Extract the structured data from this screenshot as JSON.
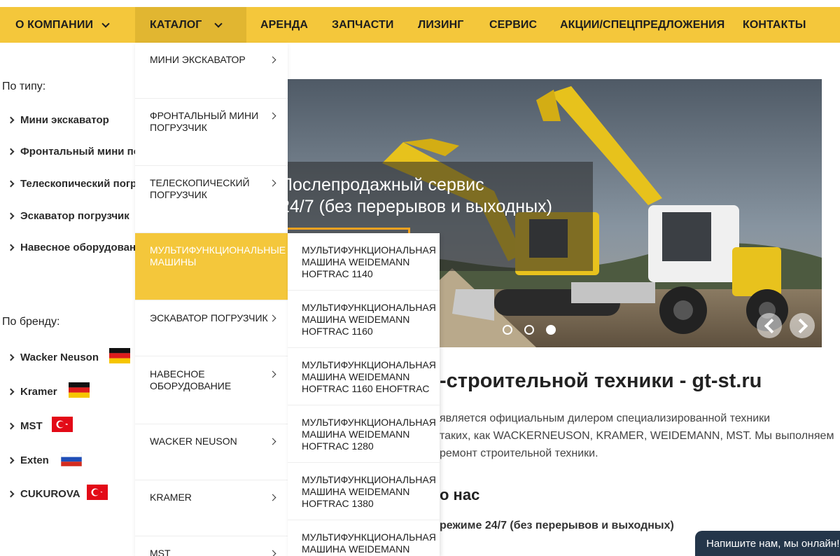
{
  "nav": {
    "items": [
      {
        "label": "О КОМПАНИИ",
        "has_dropdown": true
      },
      {
        "label": "КАТАЛОГ",
        "has_dropdown": true,
        "active": true
      },
      {
        "label": "АРЕНДА"
      },
      {
        "label": "ЗАПЧАСТИ"
      },
      {
        "label": "ЛИЗИНГ"
      },
      {
        "label": "СЕРВИС"
      },
      {
        "label": "АКЦИИ/СПЕЦПРЕДЛОЖЕНИЯ"
      },
      {
        "label": "КОНТАКТЫ"
      }
    ],
    "background": "#f4c73b"
  },
  "sidebar": {
    "by_type_label": "По типу:",
    "types": [
      "Мини экскаватор",
      "Фронтальный мини погрузчик",
      "Телескопический погрузчик",
      "Эскаватор погрузчик",
      "Навесное оборудование"
    ],
    "by_brand_label": "По бренду:",
    "brands": [
      {
        "label": "Wacker Neuson",
        "flag": "germany-flag-icon"
      },
      {
        "label": "Kramer",
        "flag": "germany-flag-icon"
      },
      {
        "label": "MST",
        "flag": "turkey-flag-icon"
      },
      {
        "label": "Exten",
        "flag": "russia-flag-icon"
      },
      {
        "label": "CUKUROVA",
        "flag": "turkey-flag-icon"
      }
    ]
  },
  "dropdown": {
    "items": [
      {
        "label": "Мини экскаватор"
      },
      {
        "label": "Фронтальный мини погрузчик"
      },
      {
        "label": "Телескопический погрузчик"
      },
      {
        "label": "Мультифункциональные машины",
        "active": true
      },
      {
        "label": "Эскаватор погрузчик"
      },
      {
        "label": "Навесное оборудование"
      },
      {
        "label": "Wacker Neuson"
      },
      {
        "label": "Kramer"
      },
      {
        "label": "MST"
      }
    ],
    "submenu": [
      "Мультифункциональная машина Weidemann Hoftrac 1140",
      "Мультифункциональная машина Weidemann Hoftrac 1160",
      "Мультифункциональная машина Weidemann Hoftrac 1160 eHoftrac",
      "Мультифункциональная машина Weidemann Hoftrac 1280",
      "Мультифункциональная машина Weidemann Hoftrac 1380",
      "Мультифункциональная машина Weidemann"
    ],
    "accent": "#f4c73b"
  },
  "hero": {
    "title_line1": "Послепродажный сервис",
    "title_line2": "24/7 (без перерывов и выходных)",
    "slides_total": 3,
    "active_slide": 3
  },
  "content": {
    "heading": "-строительной техники - gt-st.ru",
    "para_line1": "является официальным дилером специализированной техники",
    "para_line2": "таких, как WACKERNEUSON, KRAMER, WEIDEMANN, MST. Мы выполняем",
    "para_line3": "ремонт строительной техники.",
    "subheading": "о нас",
    "strong_line": "режиме 24/7 (без перерывов и выходных)"
  },
  "chat": {
    "label": "Напишите нам, мы онлайн!"
  }
}
